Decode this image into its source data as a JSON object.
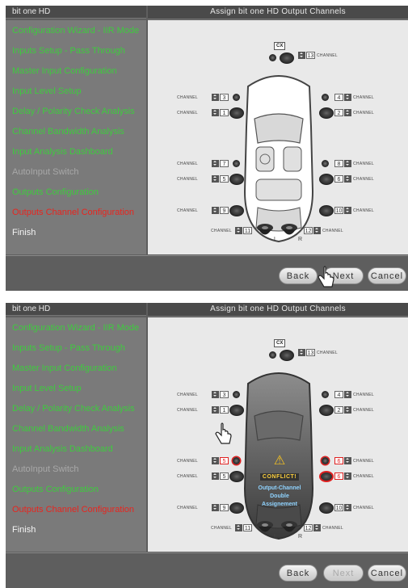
{
  "panels": [
    {
      "header_left": "bit one HD",
      "header_right": "Assign bit one HD Output Channels",
      "sidebar": [
        {
          "label": "Configuration Wizard - IIR Mode",
          "state": "done"
        },
        {
          "label": "Inputs Setup - Pass Through",
          "state": "done"
        },
        {
          "label": "Master Input Configuration",
          "state": "done"
        },
        {
          "label": "Input Level Setup",
          "state": "done"
        },
        {
          "label": "Delay / Polarity Check Analysis",
          "state": "done"
        },
        {
          "label": "Channel Bandwidth Analysis",
          "state": "done"
        },
        {
          "label": "Input Analysis Dashboard",
          "state": "done"
        },
        {
          "label": "AutoInput Switch",
          "state": "muted"
        },
        {
          "label": "Outputs Configuration",
          "state": "done"
        },
        {
          "label": "Outputs Channel Configuration",
          "state": "active"
        },
        {
          "label": "Finish",
          "state": "pending"
        }
      ],
      "channel_word": "CHANNEL",
      "cx_label": "CX",
      "channels": {
        "center": "13",
        "l_front_tw": "3",
        "l_front_wf": "1",
        "r_front_tw": "4",
        "r_front_wf": "2",
        "l_rear_tw": "7",
        "l_rear_wf": "5",
        "r_rear_tw": "8",
        "r_rear_wf": "6",
        "l_side": "9",
        "r_side": "10",
        "sub_l": "11",
        "sub_r": "12"
      },
      "sub_tags": {
        "left": "L",
        "right": "R"
      },
      "buttons": {
        "back": "Back",
        "next": "Next",
        "cancel": "Cancel"
      },
      "next_enabled": true
    },
    {
      "header_left": "bit one HD",
      "header_right": "Assign bit one HD Output Channels",
      "sidebar": [
        {
          "label": "Configuration Wizard - IIR Mode",
          "state": "done"
        },
        {
          "label": "Inputs Setup - Pass Through",
          "state": "done"
        },
        {
          "label": "Master Input Configuration",
          "state": "done"
        },
        {
          "label": "Input Level Setup",
          "state": "done"
        },
        {
          "label": "Delay / Polarity Check Analysis",
          "state": "done"
        },
        {
          "label": "Channel Bandwidth Analysis",
          "state": "done"
        },
        {
          "label": "Input Analysis Dashboard",
          "state": "done"
        },
        {
          "label": "AutoInput Switch",
          "state": "muted"
        },
        {
          "label": "Outputs Configuration",
          "state": "done"
        },
        {
          "label": "Outputs Channel Configuration",
          "state": "active"
        },
        {
          "label": "Finish",
          "state": "pending"
        }
      ],
      "channel_word": "CHANNEL",
      "cx_label": "CX",
      "channels": {
        "center": "13",
        "l_front_tw": "3",
        "l_front_wf": "1",
        "r_front_tw": "4",
        "r_front_wf": "2",
        "l_rear_tw": "5",
        "l_rear_wf": "5",
        "r_rear_tw": "6",
        "r_rear_wf": "6",
        "l_side": "9",
        "r_side": "10",
        "sub_l": "11",
        "sub_r": "12"
      },
      "sub_tags": {
        "left": "L",
        "right": "R"
      },
      "conflict": {
        "title": "CONFLICT!",
        "line1": "Output-Channel",
        "line2": "Double",
        "line3": "Assignement"
      },
      "buttons": {
        "back": "Back",
        "next": "Next",
        "cancel": "Cancel"
      },
      "next_enabled": false
    }
  ],
  "colors": {
    "done": "#3ecb3e",
    "active": "#e8251f",
    "muted": "#a8a8a8",
    "conflict": "#e02020"
  }
}
